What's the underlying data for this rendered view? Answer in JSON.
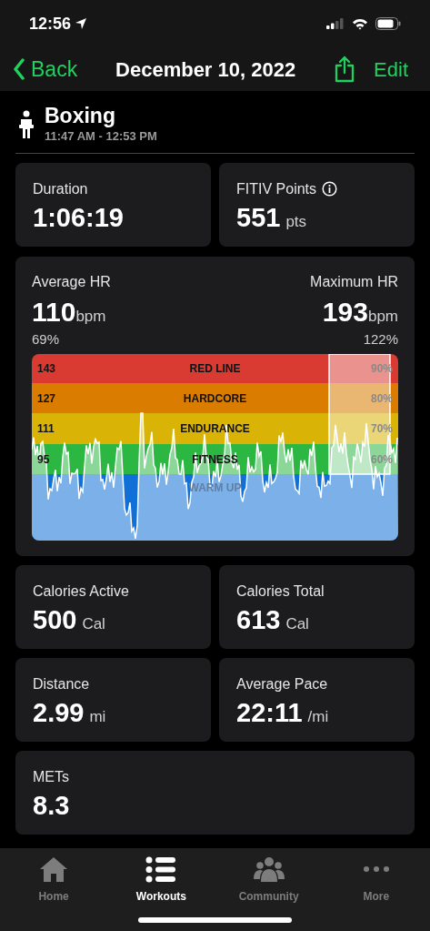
{
  "status_bar": {
    "time": "12:56"
  },
  "nav": {
    "back": "Back",
    "title": "December 10, 2022",
    "action": "Edit"
  },
  "workout": {
    "name": "Boxing",
    "time_range": "11:47 AM - 12:53 PM"
  },
  "top_stats": [
    {
      "label": "Duration",
      "value": "1:06:19",
      "info": false
    },
    {
      "label": "FITIV Points",
      "value": "551",
      "unit": "pts",
      "info": true
    }
  ],
  "heart_rate": {
    "average": {
      "label": "Average HR",
      "value": "110",
      "unit": "bpm",
      "percent": "69%"
    },
    "maximum": {
      "label": "Maximum HR",
      "value": "193",
      "unit": "bpm",
      "percent": "122%"
    },
    "zones": [
      {
        "bpm": "143",
        "name": "RED LINE",
        "percent": "90%",
        "color": "#d93a32"
      },
      {
        "bpm": "127",
        "name": "HARDCORE",
        "percent": "80%",
        "color": "#d97c00"
      },
      {
        "bpm": "111",
        "name": "ENDURANCE",
        "percent": "70%",
        "color": "#d9b406"
      },
      {
        "bpm": "95",
        "name": "FITNESS",
        "percent": "60%",
        "color": "#2cb742"
      },
      {
        "name": "WARM UP",
        "color": "#1170d8"
      }
    ]
  },
  "stats": [
    {
      "label": "Calories Active",
      "value": "500",
      "unit": "Cal"
    },
    {
      "label": "Calories Total",
      "value": "613",
      "unit": "Cal"
    },
    {
      "label": "Distance",
      "value": "2.99",
      "unit": "mi"
    },
    {
      "label": "Average Pace",
      "value": "22:11",
      "unit": "/mi"
    },
    {
      "label": "METs",
      "value": "8.3"
    }
  ],
  "tabs": [
    {
      "label": "Home",
      "selected": false
    },
    {
      "label": "Workouts",
      "selected": true
    },
    {
      "label": "Community",
      "selected": false
    },
    {
      "label": "More",
      "selected": false
    }
  ]
}
